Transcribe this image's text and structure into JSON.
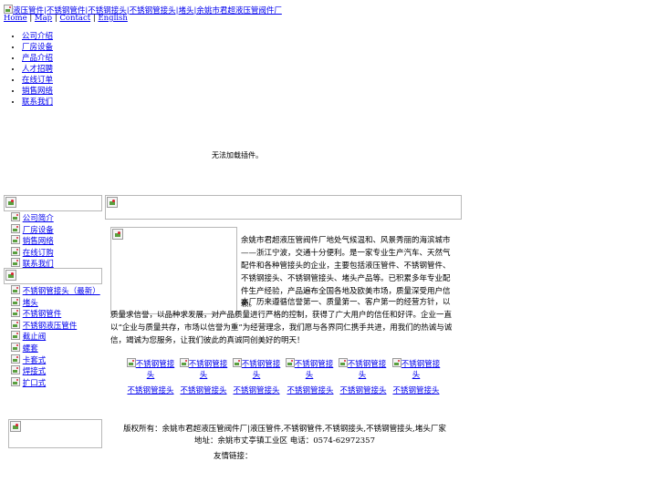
{
  "header": {
    "logo_alt": "液压管件|不锈钢管件|不锈钢接头|不锈钢管接头|堵头|余姚市君超液压管阀件厂",
    "links": [
      "Home",
      "Map",
      "Contact",
      "English"
    ],
    "separator": "|"
  },
  "top_menu": {
    "items": [
      "公司介绍",
      "厂房设备",
      "产品介绍",
      "人才招聘",
      "在线订单",
      "销售网络",
      "联系我们"
    ]
  },
  "plugin_message": "无法加载插件。",
  "left_nav": {
    "items": [
      "公司简介",
      "厂房设备",
      "销售网络",
      "在线订购",
      "联系我们"
    ]
  },
  "left_products": {
    "items": [
      "不锈钢管接头（最新）",
      "堵头",
      "不锈钢管件",
      "不锈钢液压管件",
      "截止阀",
      "螺套",
      "卡套式",
      "焊接式",
      "扩口式"
    ]
  },
  "intro": {
    "paragraph1": "余姚市君超液压管阀件厂地处气候温和、风景秀丽的海滨城市——浙江宁波，交通十分便利。是一家专业生产汽车、天然气配件和各种管接头的企业，主要包括液压管件、不锈钢管件、不锈钢接头、不锈钢管接头、堵头产品等。已积累多年专业配件生产经验，产品遍布全国各地及欧美市场，质量深受用户信赖。",
    "paragraph2": "本厂历来遵循信誉第一、质量第一、客户第一的经营方针，以质量求信誉，以品种求发展，对产品质量进行严格的控制，获得了广大用户的信任和好评。企业一直以“企业与质量共存，市场以信誉为重”为经营理念，我们愿与各界同仁携手共进，用我们的热诚与诚信，竭诚为您服务，让我们彼此的真诚同创美好的明天！"
  },
  "products": [
    {
      "alt": "不锈钢管接头",
      "caption": "不锈钢管接头"
    },
    {
      "alt": "不锈钢管接头",
      "caption": "不锈钢管接头"
    },
    {
      "alt": "不锈钢管接头",
      "caption": "不锈钢管接头"
    },
    {
      "alt": "不锈钢管接头",
      "caption": "不锈钢管接头"
    },
    {
      "alt": "不锈钢管接头",
      "caption": "不锈钢管接头"
    },
    {
      "alt": "不锈钢管接头",
      "caption": "不锈钢管接头"
    }
  ],
  "footer": {
    "copyright": "版权所有：余姚市君超液压管阀件厂|液压管件,不锈钢管件,不锈钢接头,不锈钢管接头,堵头厂家",
    "address": "地址：余姚市丈亭镇工业区 电话：0574-62972357",
    "friend_links": "友情链接："
  }
}
